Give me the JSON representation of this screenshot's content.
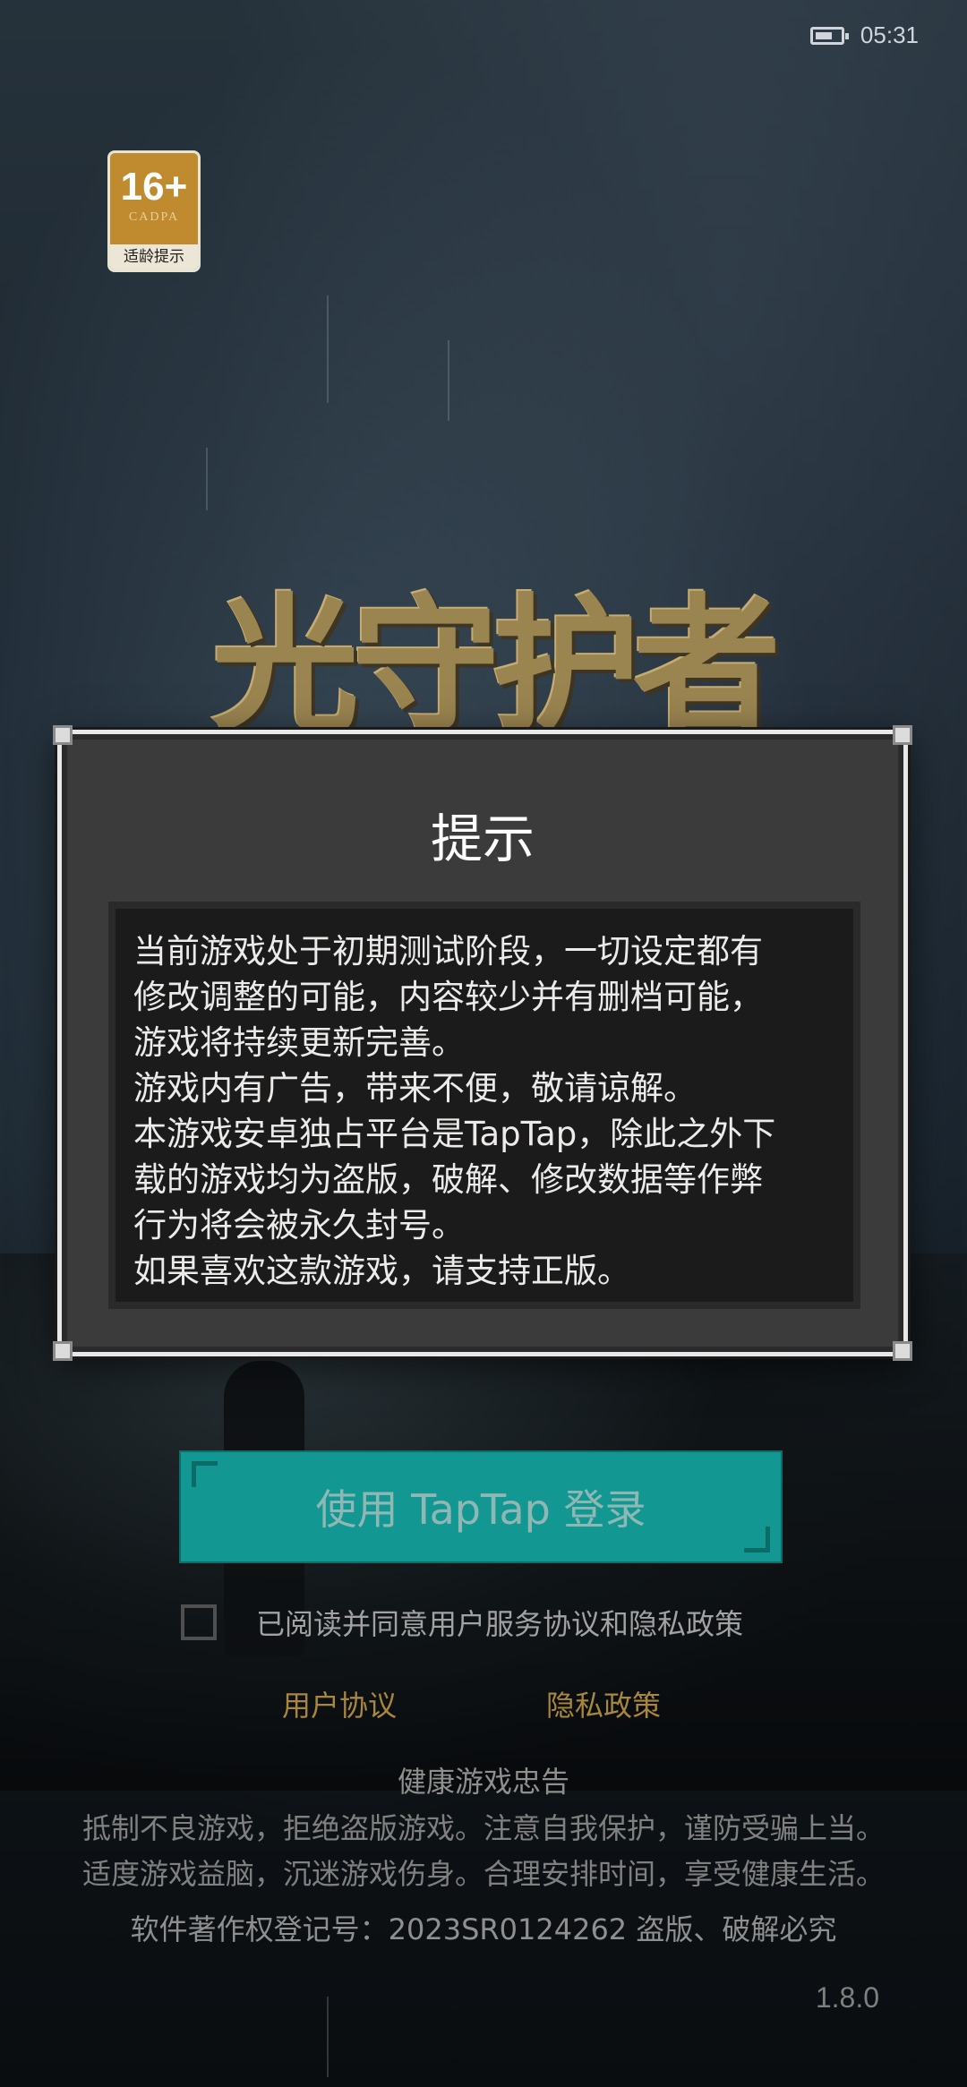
{
  "status_bar": {
    "time": "05:31",
    "battery_icon": "battery-icon"
  },
  "age_rating": {
    "age": "16+",
    "org": "CADPA",
    "tip": "适龄提示"
  },
  "game_logo": {
    "text": "光守护者"
  },
  "dialog": {
    "title": "提示",
    "lines": [
      "当前游戏处于初期测试阶段，一切设定都有",
      "修改调整的可能，内容较少并有删档可能，",
      "游戏将持续更新完善。",
      "游戏内有广告，带来不便，敬请谅解。",
      "本游戏安卓独占平台是TapTap，除此之外下",
      "载的游戏均为盗版，破解、修改数据等作弊",
      "行为将会被永久封号。",
      "如果喜欢这款游戏，请支持正版。"
    ]
  },
  "login": {
    "button_label": "使用 TapTap 登录",
    "button_color": "#129792"
  },
  "agreement": {
    "checked": false,
    "text": "已阅读并同意用户服务协议和隐私政策"
  },
  "links": {
    "user_agreement": "用户协议",
    "privacy_policy": "隐私政策",
    "color": "#a8863d"
  },
  "health_notice": {
    "title": "健康游戏忠告",
    "line1": "抵制不良游戏，拒绝盗版游戏。注意自我保护，谨防受骗上当。",
    "line2": "适度游戏益脑，沉迷游戏伤身。合理安排时间，享受健康生活。"
  },
  "copyright": "软件著作权登记号：2023SR0124262 盗版、破解必究",
  "version": "1.8.0"
}
